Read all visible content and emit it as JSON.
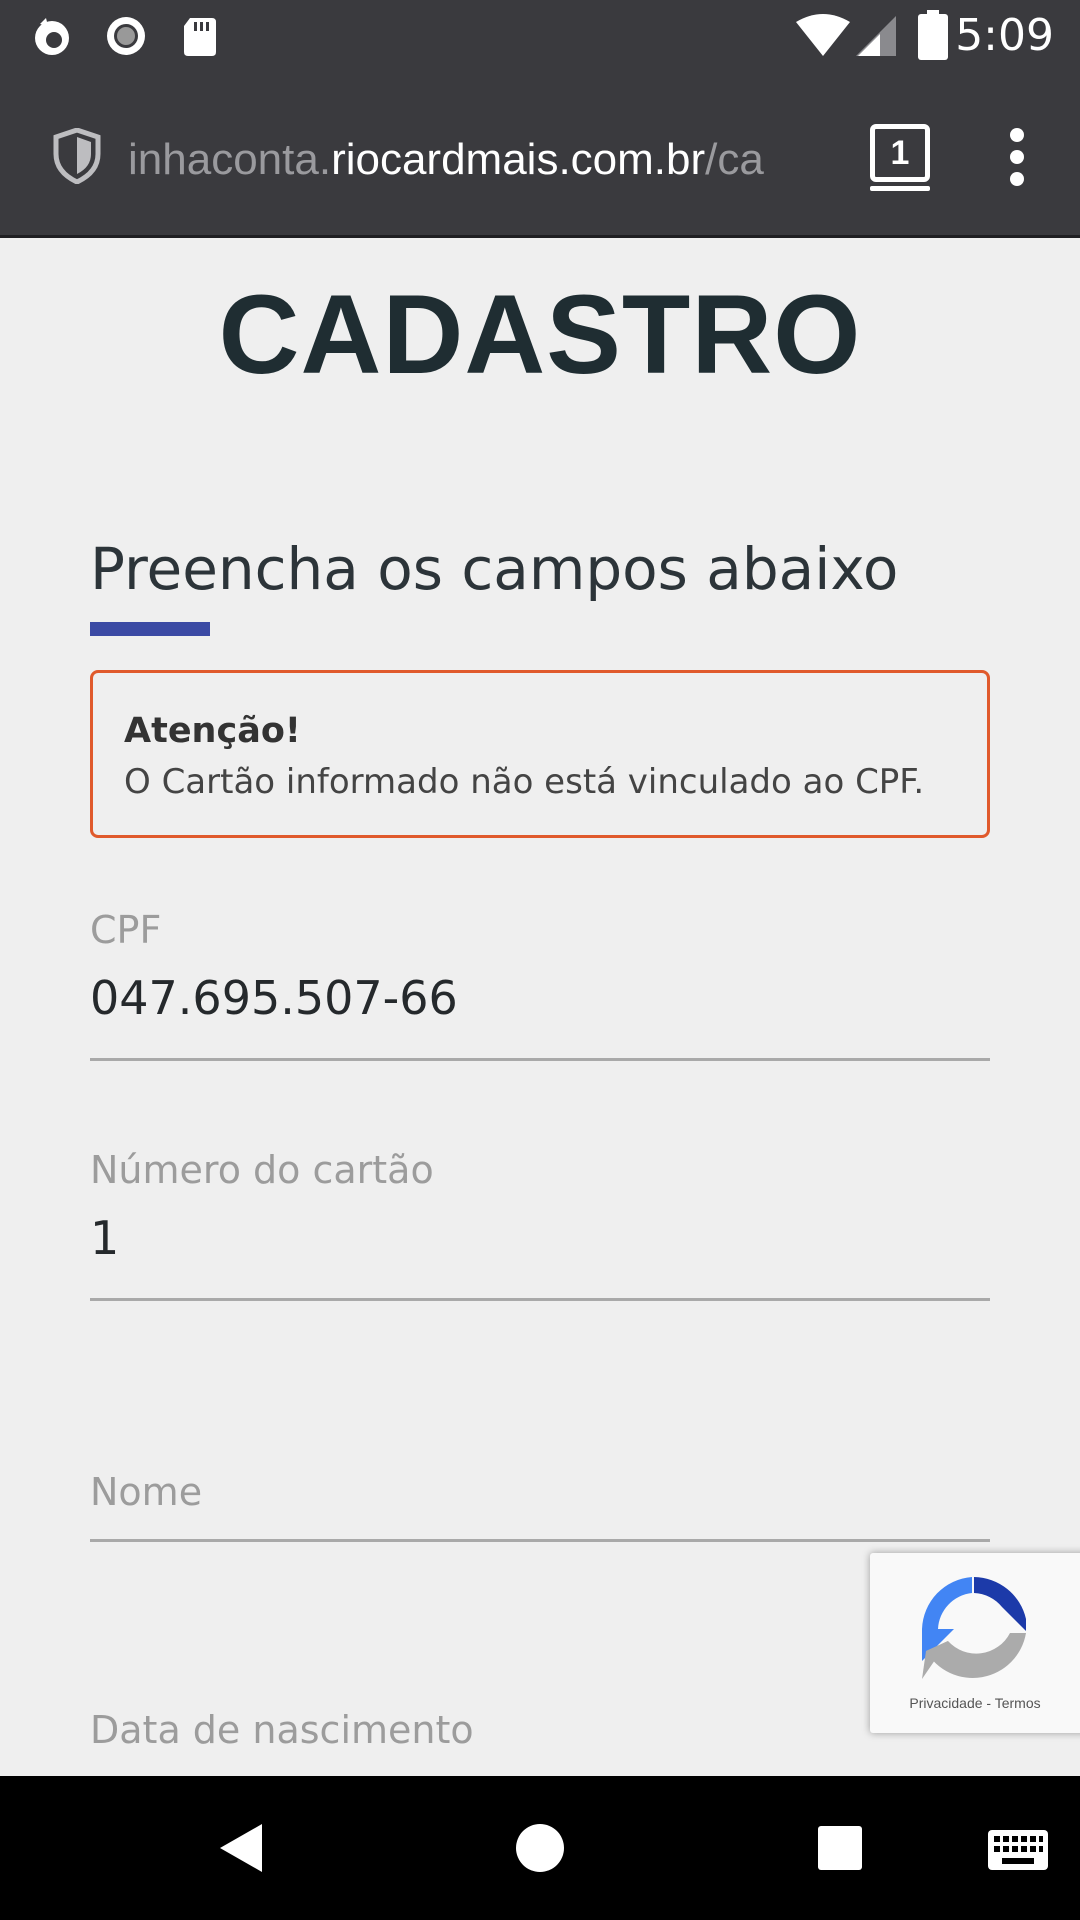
{
  "status_bar": {
    "time": "5:09",
    "icons": [
      "firefox-icon",
      "record-icon",
      "sd-card-icon",
      "wifi-icon",
      "signal-icon",
      "battery-icon"
    ]
  },
  "browser": {
    "url_subdomain": "inhaconta.",
    "url_host": "riocardmais.com.br",
    "url_path": "/ca",
    "tab_count": "1"
  },
  "page": {
    "title": "CADASTRO",
    "section_heading": "Preencha os campos abaixo",
    "accent_color": "#3b4aa4",
    "alert": {
      "title": "Atenção!",
      "message": "O Cartão informado não está vinculado ao CPF.",
      "border_color": "#e05a2c"
    },
    "fields": {
      "cpf": {
        "label": "CPF",
        "value": "047.695.507-66"
      },
      "card_number": {
        "label": "Número do cartão",
        "value": "1"
      },
      "name": {
        "label": "Nome",
        "value": ""
      },
      "birth_date": {
        "label": "Data de nascimento",
        "value": ""
      }
    }
  },
  "recaptcha": {
    "links": "Privacidade - Termos"
  }
}
